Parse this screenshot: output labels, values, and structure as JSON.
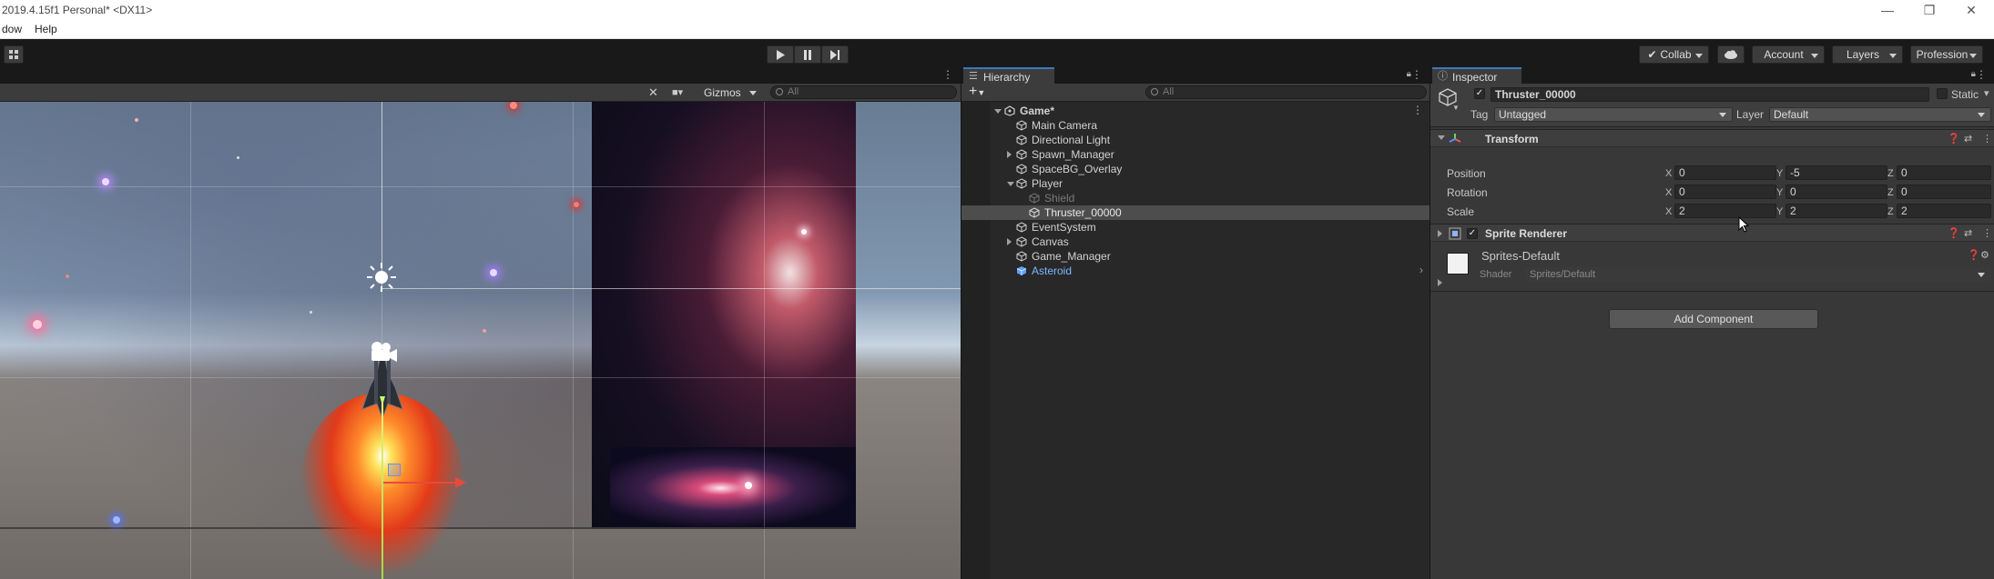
{
  "window": {
    "title": "2019.4.15f1 Personal* <DX11>",
    "menu": [
      "dow",
      "Help"
    ],
    "controls": {
      "minimize": "—",
      "restore": "❐",
      "close": "✕"
    }
  },
  "toolbar": {
    "play_icon": "play-icon",
    "pause_icon": "pause-icon",
    "step_icon": "step-icon",
    "collab": "Collab",
    "account": "Account",
    "layers": "Layers",
    "layout": "Profession"
  },
  "scene": {
    "gizmos": "Gizmos",
    "search_placeholder": "All"
  },
  "hierarchy": {
    "tab": "Hierarchy",
    "add": "+",
    "search_placeholder": "All",
    "scene_name": "Game*",
    "items": [
      {
        "label": "Main Camera",
        "depth": 1,
        "fold": "none",
        "state": "normal"
      },
      {
        "label": "Directional Light",
        "depth": 1,
        "fold": "none",
        "state": "normal"
      },
      {
        "label": "Spawn_Manager",
        "depth": 1,
        "fold": "collapsed",
        "state": "normal"
      },
      {
        "label": "SpaceBG_Overlay",
        "depth": 1,
        "fold": "none",
        "state": "normal"
      },
      {
        "label": "Player",
        "depth": 1,
        "fold": "expanded",
        "state": "normal"
      },
      {
        "label": "Shield",
        "depth": 2,
        "fold": "none",
        "state": "disabled"
      },
      {
        "label": "Thruster_00000",
        "depth": 2,
        "fold": "none",
        "state": "selected"
      },
      {
        "label": "EventSystem",
        "depth": 1,
        "fold": "none",
        "state": "normal"
      },
      {
        "label": "Canvas",
        "depth": 1,
        "fold": "collapsed",
        "state": "normal"
      },
      {
        "label": "Game_Manager",
        "depth": 1,
        "fold": "none",
        "state": "normal"
      },
      {
        "label": "Asteroid",
        "depth": 1,
        "fold": "none",
        "state": "prefab"
      }
    ]
  },
  "inspector": {
    "tab": "Inspector",
    "object_name": "Thruster_00000",
    "static_label": "Static",
    "tag_label": "Tag",
    "tag_value": "Untagged",
    "layer_label": "Layer",
    "layer_value": "Default",
    "transform": {
      "title": "Transform",
      "rows": [
        {
          "label": "Position",
          "x": "0",
          "y": "-5",
          "z": "0"
        },
        {
          "label": "Rotation",
          "x": "0",
          "y": "0",
          "z": "0"
        },
        {
          "label": "Scale",
          "x": "2",
          "y": "2",
          "z": "2"
        }
      ]
    },
    "sprite_renderer": {
      "title": "Sprite Renderer",
      "material": "Sprites-Default",
      "shader_label": "Shader",
      "shader_value": "Sprites/Default"
    },
    "add_component": "Add Component"
  },
  "colors": {
    "accent": "#3a79bb",
    "selection": "#4d4d4d",
    "prefab_text": "#7eb6ff",
    "handle_x": "#e84a3c"
  }
}
